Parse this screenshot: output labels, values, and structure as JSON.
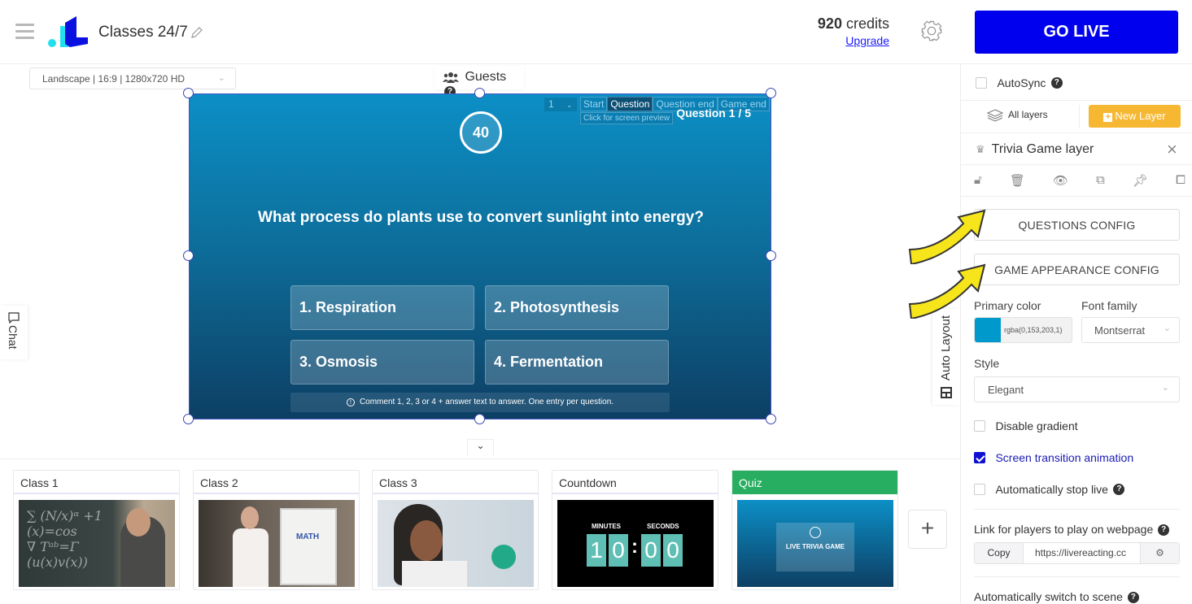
{
  "header": {
    "app_title": "Classes 24/7",
    "credits_value": "920",
    "credits_label": "credits",
    "upgrade_label": "Upgrade",
    "go_live_label": "GO LIVE",
    "accent_color": "#0000ee"
  },
  "canvas": {
    "resolution_select": "Landscape | 16:9 | 1280x720 HD",
    "guests_label": "Guests",
    "chat_label": "Chat",
    "auto_layout_label": "Auto Layout"
  },
  "trivia": {
    "timer": "40",
    "question_counter": "Question 1 / 5",
    "question_select": "1",
    "screen_tabs": [
      "Start",
      "Question",
      "Question end",
      "Game end"
    ],
    "active_tab": "Question",
    "preview_hint": "Click for screen preview",
    "question": "What process do plants use to convert sunlight into energy?",
    "answers": [
      "1. Respiration",
      "2. Photosynthesis",
      "3. Osmosis",
      "4. Fermentation"
    ],
    "instruction": "Comment 1, 2, 3 or 4 + answer text to answer. One entry per question."
  },
  "scenes": [
    {
      "name": "Class 1",
      "active": false
    },
    {
      "name": "Class 2",
      "active": false
    },
    {
      "name": "Class 3",
      "active": false
    },
    {
      "name": "Countdown",
      "active": false,
      "minutes_label": "MINUTES",
      "seconds_label": "SECONDS",
      "digits": [
        "1",
        "0",
        "0",
        "0"
      ]
    },
    {
      "name": "Quiz",
      "active": true,
      "thumb_title": "LIVE TRIVIA GAME"
    }
  ],
  "panel": {
    "autosync_label": "AutoSync",
    "all_layers_label": "All layers",
    "new_layer_label": "New Layer",
    "layer_title": "Trivia Game layer",
    "questions_config_label": "QUESTIONS CONFIG",
    "appearance_config_label": "GAME APPEARANCE CONFIG",
    "primary_color_label": "Primary color",
    "primary_color_value": "rgba(0,153,203,1)",
    "primary_color_hex": "#0099cb",
    "font_family_label": "Font family",
    "font_family_value": "Montserrat",
    "style_label": "Style",
    "style_value": "Elegant",
    "disable_gradient_label": "Disable gradient",
    "disable_gradient_checked": false,
    "screen_transition_label": "Screen transition animation",
    "screen_transition_checked": true,
    "auto_stop_label": "Automatically stop live",
    "auto_stop_checked": false,
    "link_label": "Link for players to play on webpage",
    "copy_label": "Copy",
    "link_value": "https://livereacting.cc",
    "auto_switch_label": "Automatically switch to scene"
  }
}
